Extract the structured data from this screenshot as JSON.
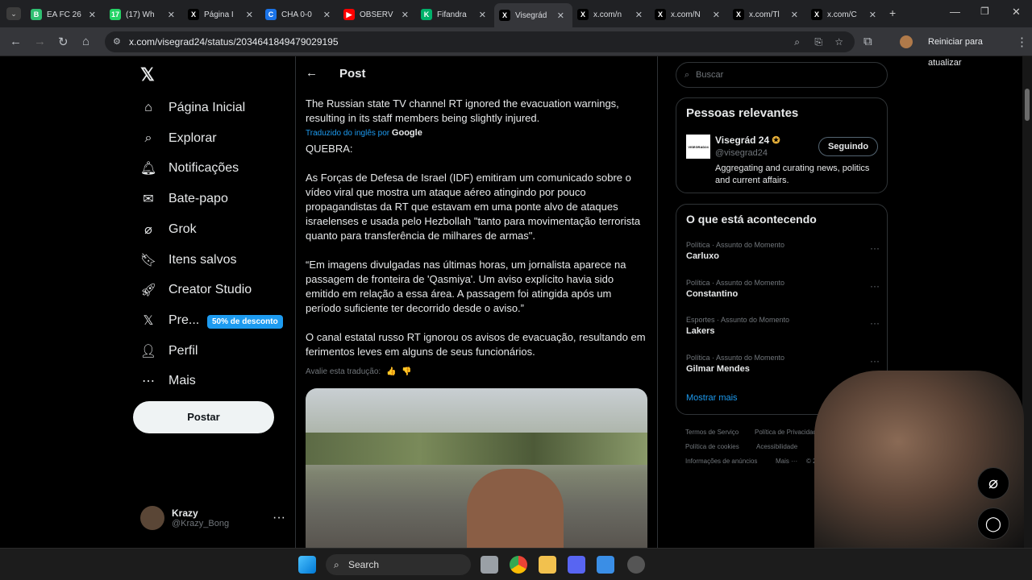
{
  "browser": {
    "tabs": [
      {
        "label": "EA FC 26",
        "color": "#2fbf71",
        "glyph": "B"
      },
      {
        "label": "(17) Wh",
        "color": "#25d366",
        "glyph": "17"
      },
      {
        "label": "Página I",
        "color": "#000000",
        "glyph": "X"
      },
      {
        "label": "CHA 0-0",
        "color": "#1a73e8",
        "glyph": "C"
      },
      {
        "label": "OBSERV",
        "color": "#ff0000",
        "glyph": "▶"
      },
      {
        "label": "Fifandra",
        "color": "#00b16a",
        "glyph": "K"
      },
      {
        "label": "Visegrád",
        "color": "#000000",
        "glyph": "X"
      },
      {
        "label": "x.com/n",
        "color": "#000000",
        "glyph": "X"
      },
      {
        "label": "x.com/N",
        "color": "#000000",
        "glyph": "X"
      },
      {
        "label": "x.com/Tl",
        "color": "#000000",
        "glyph": "X"
      },
      {
        "label": "x.com/C",
        "color": "#000000",
        "glyph": "X"
      }
    ],
    "url": "x.com/visegrad24/status/2034641849479029195",
    "restart_label": "Reiniciar para atualizar"
  },
  "sidebar": {
    "items": [
      {
        "label": "Página Inicial",
        "icon": "home-icon"
      },
      {
        "label": "Explorar",
        "icon": "search-icon"
      },
      {
        "label": "Notificações",
        "icon": "bell-icon"
      },
      {
        "label": "Bate-papo",
        "icon": "mail-icon"
      },
      {
        "label": "Grok",
        "icon": "grok-icon"
      },
      {
        "label": "Itens salvos",
        "icon": "bookmark-icon"
      },
      {
        "label": "Creator Studio",
        "icon": "rocket-icon"
      },
      {
        "label": "Pre...",
        "icon": "x-logo-icon"
      },
      {
        "label": "Perfil",
        "icon": "person-icon"
      },
      {
        "label": "Mais",
        "icon": "more-circle-icon"
      }
    ],
    "premium_badge": "50% de desconto",
    "post_label": "Postar",
    "user": {
      "name": "Krazy",
      "handle": "@Krazy_Bong"
    }
  },
  "post": {
    "title": "Post",
    "original_text": "The Russian state TV channel RT ignored the evacuation warnings, resulting in its staff members being slightly injured.",
    "translated_by": "Traduzido do inglês por",
    "translator": "Google",
    "p1": "QUEBRA:",
    "p2": "As Forças de Defesa de Israel (IDF) emitiram um comunicado sobre o vídeo viral que mostra um ataque aéreo atingindo por pouco propagandistas da RT que estavam em uma ponte alvo de ataques israelenses e usada pelo Hezbollah \"tanto para movimentação terrorista quanto para transferência de milhares de armas\".",
    "p3": "“Em imagens divulgadas nas últimas horas, um jornalista aparece na passagem de fronteira de 'Qasmiya'. Um aviso explícito havia sido emitido em relação a essa área. A passagem foi atingida após um período suficiente ter decorrido desde o aviso.”",
    "p4": "O canal estatal russo RT ignorou os avisos de evacuação, resultando em ferimentos leves em alguns de seus funcionários.",
    "rate_translation": "Avalie esta tradução:"
  },
  "right": {
    "search_placeholder": "Buscar",
    "relevant_title": "Pessoas relevantes",
    "person": {
      "name": "Visegrád 24",
      "handle": "@visegrad24",
      "bio": "Aggregating and curating news, politics and current affairs.",
      "follow": "Seguindo",
      "avatar_text": "VISEGRAD24"
    },
    "trending_title": "O que está acontecendo",
    "trends": [
      {
        "meta": "Política · Assunto do Momento",
        "name": "Carluxo"
      },
      {
        "meta": "Política · Assunto do Momento",
        "name": "Constantino"
      },
      {
        "meta": "Esportes · Assunto do Momento",
        "name": "Lakers"
      },
      {
        "meta": "Política · Assunto do Momento",
        "name": "Gilmar Mendes"
      }
    ],
    "show_more": "Mostrar mais",
    "footer": {
      "terms": "Termos de Serviço",
      "privacy": "Política de Privacidade",
      "cookies": "Política de cookies",
      "access": "Acessibilidade",
      "ads": "Informações de anúncios",
      "more": "Mais ···",
      "copy": "© 2026 X Corp."
    }
  },
  "taskbar": {
    "search": "Search"
  }
}
